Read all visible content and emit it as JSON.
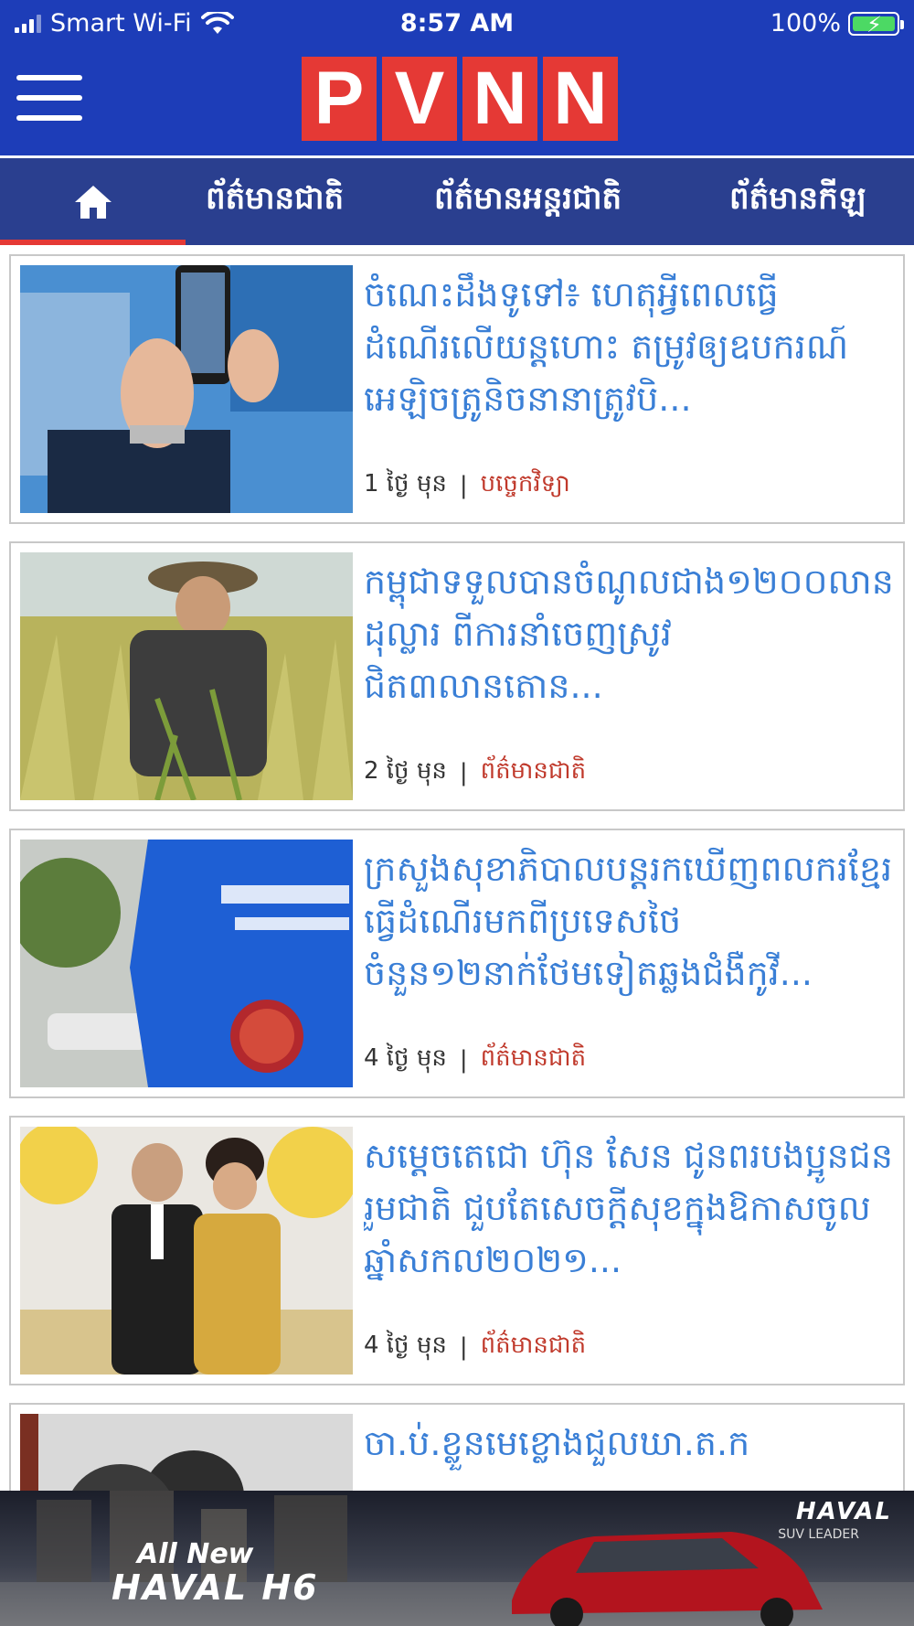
{
  "status_bar": {
    "carrier": "Smart Wi-Fi",
    "time": "8:57 AM",
    "battery": "100%"
  },
  "header": {
    "logo_letters": [
      "P",
      "V",
      "N",
      "N"
    ]
  },
  "tabs": [
    {
      "icon": "home-icon",
      "label": ""
    },
    {
      "label": "ព័ត៌មានជាតិ"
    },
    {
      "label": "ព័ត៌មានអន្តរជាតិ"
    },
    {
      "label": "ព័ត៌មានកីឡ"
    }
  ],
  "articles": [
    {
      "title": "ចំណេះដឹងទូទៅ៖ ហេតុអ្វីពេលធ្វើដំណើរលើយន្តហោះ តម្រូវឲ្យឧបករណ៍អេឡិចត្រូនិចនានាត្រូវបិ...",
      "time": "1 ថ្ងៃ មុន",
      "separator": "|",
      "category": "បច្ចេកវិទ្យា"
    },
    {
      "title": "កម្ពុជាទទួលបានចំណូលជាង១២០០លានដុល្លារ ពីការនាំចេញស្រូវជិត៣លានតោន...",
      "time": "2 ថ្ងៃ មុន",
      "separator": "|",
      "category": "ព័ត៌មានជាតិ"
    },
    {
      "title": "ក្រសួងសុខាភិបាលបន្តរកឃើញពលករខ្មែរ ធ្វើដំណើរមកពីប្រទេសថៃចំនួន១២នាក់ថែមទៀតឆ្លងជំងឺកូវី...",
      "time": "4 ថ្ងៃ មុន",
      "separator": "|",
      "category": "ព័ត៌មានជាតិ"
    },
    {
      "title": "សម្តេចតេជោ ហ៊ុន សែន ជូនពរបងប្អូនជនរួមជាតិ ជួបតែសេចក្តីសុខក្នុងឱកាសចូលឆ្នាំសកល២០២១...",
      "time": "4 ថ្ងៃ មុន",
      "separator": "|",
      "category": "ព័ត៌មានជាតិ"
    },
    {
      "title": "ចា.ប់.ខ្លួនមេខ្លោងជួលឃា.ត.ក",
      "time": "",
      "separator": "",
      "category": ""
    }
  ],
  "ad": {
    "brand": "HAVAL",
    "brand_tagline": "SUV LEADER",
    "headline_1": "All New",
    "headline_2": "HAVAL H6"
  },
  "colors": {
    "header_blue": "#1d3db8",
    "tabs_blue": "#2a3f8f",
    "logo_red": "#e53935",
    "headline_blue": "#3a7fd6",
    "category_red": "#c0392b"
  }
}
